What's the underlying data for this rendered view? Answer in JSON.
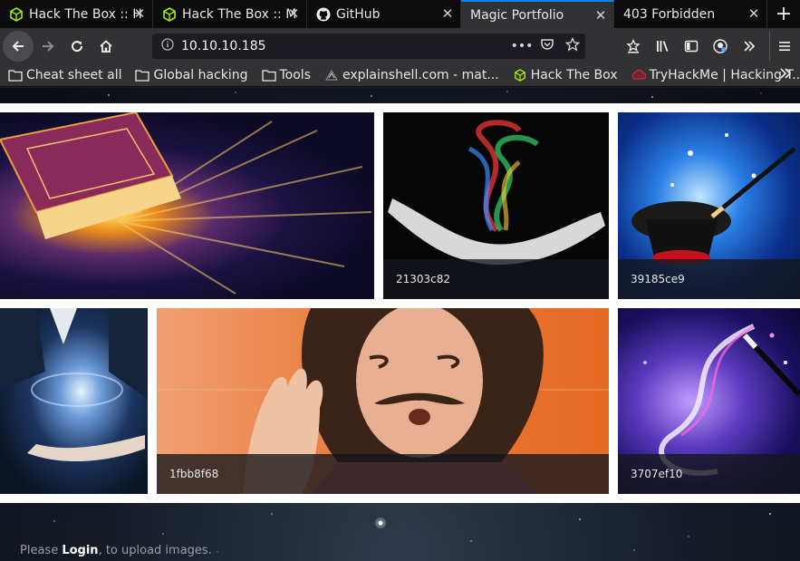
{
  "tabs": [
    {
      "title": "Hack The Box :: H",
      "icon": "htb-icon",
      "close": "✕"
    },
    {
      "title": "Hack The Box :: M",
      "icon": "htb-icon",
      "close": "✕"
    },
    {
      "title": "GitHub",
      "icon": "github-icon",
      "close": "✕"
    },
    {
      "title": "Magic Portfolio",
      "icon": "",
      "close": "✕",
      "active": true
    },
    {
      "title": "403 Forbidden",
      "icon": "",
      "close": "✕"
    }
  ],
  "new_tab": "+",
  "navbar": {
    "url": "10.10.10.185",
    "page_actions": "•••"
  },
  "bookmarks": [
    {
      "label": "Cheat sheet all",
      "icon": "folder-icon"
    },
    {
      "label": "Global hacking",
      "icon": "folder-icon"
    },
    {
      "label": "Tools",
      "icon": "folder-icon"
    },
    {
      "label": "explainshell.com - mat...",
      "icon": "explainshell-icon"
    },
    {
      "label": "Hack The Box",
      "icon": "htb-icon"
    },
    {
      "label": "TryHackMe | Hacking T...",
      "icon": "tryhackme-icon"
    }
  ],
  "gallery": [
    {
      "caption": "",
      "art": "magic-book"
    },
    {
      "caption": "21303c82",
      "art": "rainbow-smoke-hand"
    },
    {
      "caption": "39185ce9",
      "art": "magic-hat-wand"
    },
    {
      "caption": "",
      "art": "galaxy-hand"
    },
    {
      "caption": "1fbb8f68",
      "art": "surprised-man"
    },
    {
      "caption": "3707ef10",
      "art": "sparkle-wand"
    }
  ],
  "footer": {
    "prefix": "Please ",
    "login_link": "Login",
    "suffix": ", to upload images."
  },
  "colors": {
    "active_tab_accent": "#0a84ff",
    "htb_green": "#9fef00",
    "toolbar": "#323234",
    "tabstrip": "#0c0c0d"
  }
}
